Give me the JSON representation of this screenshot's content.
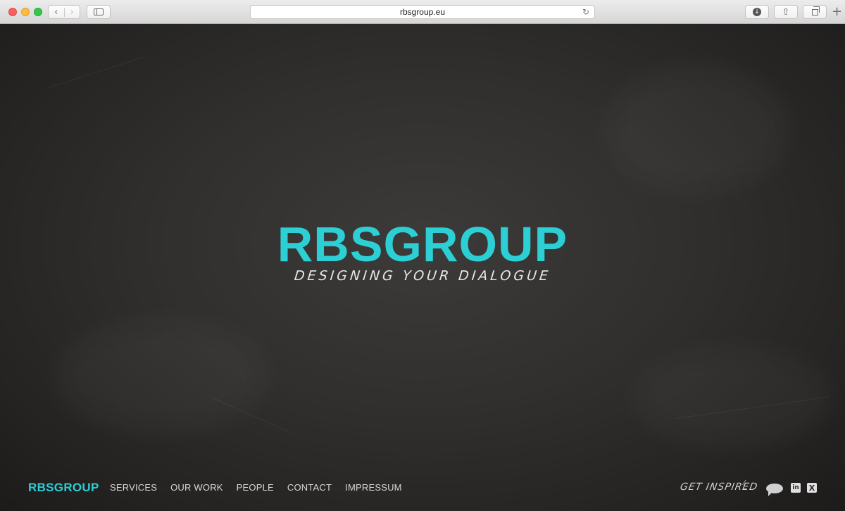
{
  "browser": {
    "url": "rbsgroup.eu",
    "icons": {
      "back": "chevron-left-icon",
      "forward": "chevron-right-icon",
      "sidebar": "sidebar-icon",
      "reload": "reload-icon",
      "download": "download-icon",
      "share": "share-icon",
      "tabs": "tabs-icon",
      "new_tab": "plus-icon"
    }
  },
  "hero": {
    "title": "RBSGROUP",
    "tagline": "Designing your dialogue"
  },
  "footer": {
    "logo": "RBSGROUP",
    "nav": [
      "SERVICES",
      "OUR WORK",
      "PEOPLE",
      "CONTACT",
      "IMPRESSUM"
    ],
    "get_inspired": "GET INSPIRED",
    "social": {
      "linkedin": "in",
      "xing": "X"
    }
  },
  "colors": {
    "brand": "#2ccfd4",
    "chalkboard": "#302f2d"
  }
}
